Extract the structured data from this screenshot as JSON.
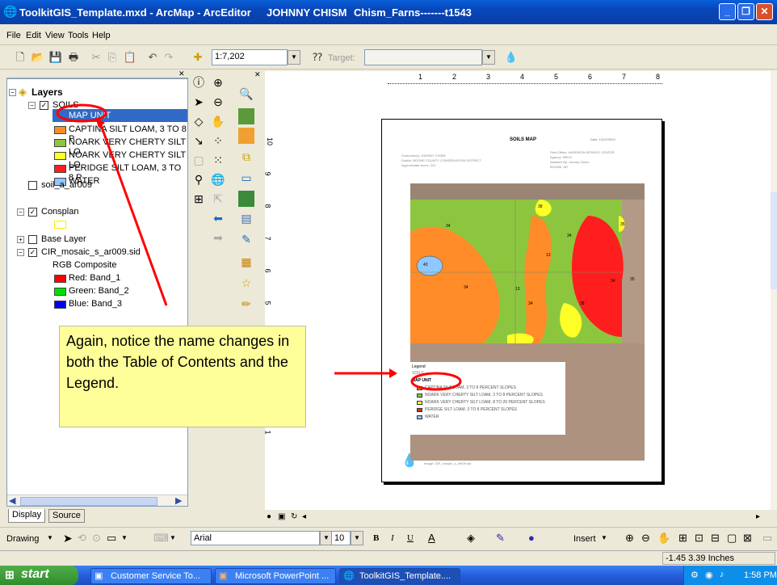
{
  "window": {
    "app_title": "ToolkitGIS_Template.mxd - ArcMap - ArcEditor",
    "user": "JOHNNY CHISM",
    "doc": "Chism_Farns-------t1543"
  },
  "menu": [
    "File",
    "Edit",
    "View",
    "Tools",
    "Help"
  ],
  "toolbar": {
    "scale": "1:7,202",
    "target_label": "Target:",
    "target_value": ""
  },
  "toc": {
    "root": "Layers",
    "soils": "SOILS",
    "map_unit": "MAP UNIT",
    "classes": [
      {
        "label": "CAPTINA SILT LOAM, 3 TO 8 P",
        "color": "#ff8c28"
      },
      {
        "label": "NOARK VERY CHERTY SILT LO.",
        "color": "#8cc63e"
      },
      {
        "label": "NOARK VERY CHERTY SILT LO.",
        "color": "#ffff28"
      },
      {
        "label": "PERIDGE SILT LOAM, 3 TO 8 P",
        "color": "#ff1e1e"
      },
      {
        "label": "WATER",
        "color": "#8ec8ff"
      }
    ],
    "soil_a": "soil_a_ar009",
    "consplan": "Consplan",
    "base_layer": "Base Layer",
    "cir": "CIR_mosaic_s_ar009.sid",
    "rgb": "RGB Composite",
    "bands": [
      {
        "label": "Red:   Band_1",
        "color": "#ff0000"
      },
      {
        "label": "Green: Band_2",
        "color": "#00e000"
      },
      {
        "label": "Blue:  Band_3",
        "color": "#0000ff"
      }
    ]
  },
  "tabs": {
    "display": "Display",
    "source": "Source"
  },
  "callout": "Again, notice the name changes in both the Table of Contents and the Legend.",
  "layout": {
    "map_title": "SOILS MAP",
    "date": "Date: 12/22/2004",
    "left_info": [
      "Customer(s): JOHNNY CHISM",
      "District: BOONE COUNTY CONSERVATION DISTRICT",
      "Approximate Acres: 241"
    ],
    "right_info": [
      "Field Office: HARRISON SERVICE CENTER",
      "Agency: NRCS",
      "Assisted By: Johnny Chism",
      "BOONE, AR"
    ],
    "legend_title": "Legend",
    "legend_soils": "SOILS",
    "legend_map_unit": "MAP UNIT",
    "legend_rows": [
      {
        "label": "CAPTINA SILT LOAM, 3 TO 8 PERCENT SLOPES",
        "color": "#ff8c28"
      },
      {
        "label": "NOARK VERY CHERTY SILT LOAM, 3 TO 8 PERCENT SLOPES",
        "color": "#8cc63e"
      },
      {
        "label": "NOARK VERY CHERTY SILT LOAM, 8 TO 20 PERCENT SLOPES",
        "color": "#ffff28"
      },
      {
        "label": "PERIDGE SILT LOAM, 3 TO 8 PERCENT SLOPES",
        "color": "#ff1e1e"
      },
      {
        "label": "WATER",
        "color": "#8ec8ff"
      }
    ],
    "image_note": "Image: CIR_mosaic_s_ar009.sid",
    "map_labels": [
      "34",
      "38",
      "35",
      "34",
      "13",
      "43",
      "34",
      "13",
      "34",
      "38",
      "35",
      "34"
    ]
  },
  "ruler_h": [
    "1",
    "2",
    "3",
    "4",
    "5",
    "6",
    "7",
    "8"
  ],
  "ruler_v": [
    "10",
    "9",
    "8",
    "7",
    "6",
    "5",
    "4",
    "3",
    "2",
    "1"
  ],
  "drawbar": {
    "drawing": "Drawing",
    "font": "Arial",
    "size": "10",
    "insert": "Insert"
  },
  "status": {
    "coords": "-1.45  3.39 Inches"
  },
  "taskbar": {
    "start": "start",
    "tasks": [
      "Customer Service To...",
      "Microsoft PowerPoint ...",
      "ToolkitGIS_Template...."
    ],
    "clock": "1:58 PM"
  }
}
